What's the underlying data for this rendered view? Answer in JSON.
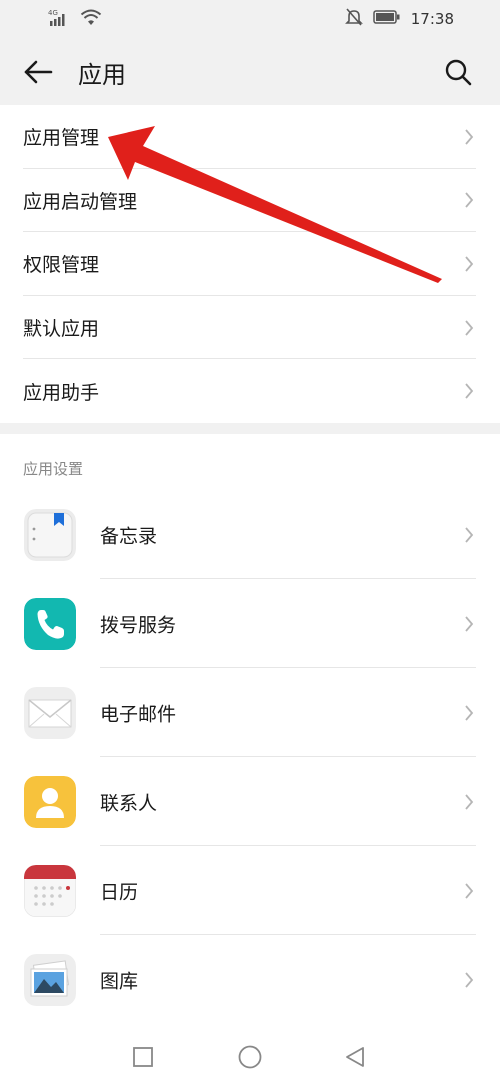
{
  "status_bar": {
    "signal_label": "4G",
    "time": "17:38",
    "icons": [
      "signal-icon",
      "wifi-icon",
      "mute-bell-icon",
      "battery-icon"
    ]
  },
  "header": {
    "title": "应用",
    "back_icon": "back-arrow-icon",
    "search_icon": "search-icon"
  },
  "menu": {
    "items": [
      {
        "label": "应用管理"
      },
      {
        "label": "应用启动管理"
      },
      {
        "label": "权限管理"
      },
      {
        "label": "默认应用"
      },
      {
        "label": "应用助手"
      }
    ]
  },
  "app_settings": {
    "header": "应用设置",
    "items": [
      {
        "label": "备忘录",
        "icon": "notepad-icon"
      },
      {
        "label": "拨号服务",
        "icon": "phone-icon"
      },
      {
        "label": "电子邮件",
        "icon": "email-icon"
      },
      {
        "label": "联系人",
        "icon": "contacts-icon"
      },
      {
        "label": "日历",
        "icon": "calendar-icon"
      },
      {
        "label": "图库",
        "icon": "gallery-icon"
      }
    ]
  },
  "navigation": {
    "icons": [
      "recent-apps-icon",
      "home-icon",
      "back-icon"
    ]
  },
  "colors": {
    "background": "#f1f1f1",
    "card": "#ffffff",
    "annotation_arrow": "#e0201b",
    "phone_icon": "#12b8b0",
    "contacts_icon": "#f7c23c",
    "calendar_top": "#c9363d"
  }
}
